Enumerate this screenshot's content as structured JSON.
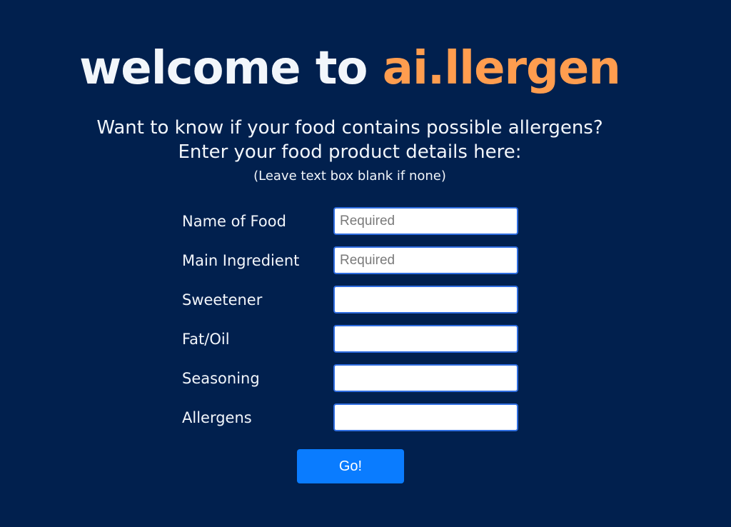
{
  "header": {
    "title_prefix": "welcome to ",
    "title_brand": "ai.llergen"
  },
  "intro": {
    "line1": "Want to know if your food contains possible allergens?",
    "line2": "Enter your food product details here:",
    "note": "(Leave text box blank if none)"
  },
  "form": {
    "fields": [
      {
        "label": "Name of Food",
        "placeholder": "Required",
        "value": ""
      },
      {
        "label": "Main Ingredient",
        "placeholder": "Required",
        "value": ""
      },
      {
        "label": "Sweetener",
        "placeholder": "",
        "value": ""
      },
      {
        "label": "Fat/Oil",
        "placeholder": "",
        "value": ""
      },
      {
        "label": "Seasoning",
        "placeholder": "",
        "value": ""
      },
      {
        "label": "Allergens",
        "placeholder": "",
        "value": ""
      }
    ],
    "submit_label": "Go!"
  },
  "colors": {
    "background": "#01204e",
    "brand_accent": "#ff9d4f",
    "button": "#0a7cff"
  }
}
